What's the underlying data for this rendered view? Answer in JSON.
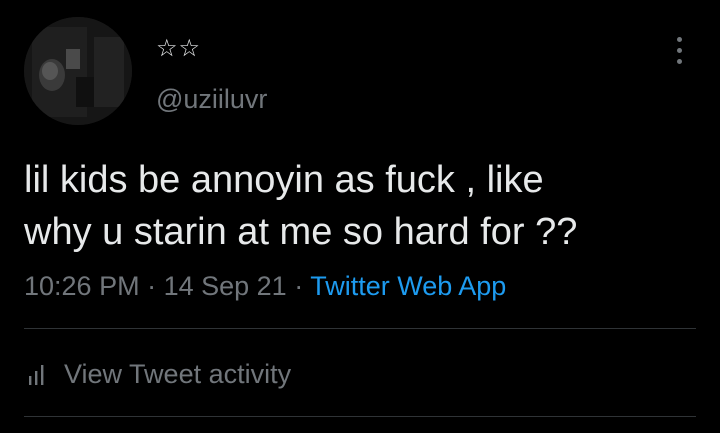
{
  "tweet": {
    "display_name": "☆☆",
    "handle": "@uziiluvr",
    "text": "lil kids be annoyin as fuck , like\nwhy u starin at me so hard for ??",
    "time": "10:26 PM",
    "separator": " · ",
    "date": "14 Sep 21",
    "source": "Twitter Web App",
    "activity_label": "View Tweet activity",
    "avatar_icon": "profile-photo",
    "more_icon": "more-vertical-icon",
    "activity_icon": "bar-chart-icon"
  },
  "colors": {
    "background": "#000000",
    "primary_text": "#e7e9ea",
    "secondary_text": "#71767b",
    "link": "#1d9bf0",
    "divider": "#2f3336"
  }
}
